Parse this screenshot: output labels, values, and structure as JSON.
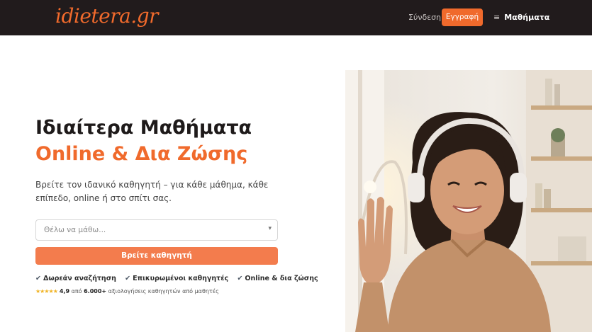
{
  "header": {
    "logo": "idietera.gr",
    "login_label": "Σύνδεση",
    "register_label": "Εγγραφή",
    "subjects_label": "Μαθήματα",
    "menu_glyph": "≡"
  },
  "hero": {
    "title_line1": "Ιδιαίτερα Μαθήματα",
    "title_line2": "Online & Δια Ζώσης",
    "subtitle": "Βρείτε τον ιδανικό καθηγητή – για κάθε μάθημα, κάθε επίπεδο, online ή στο σπίτι σας.",
    "select_placeholder": "Θέλω να μάθω...",
    "cta_label": "Βρείτε καθηγητή",
    "features": [
      "Δωρεάν αναζήτηση",
      "Επικυρωμένοι καθηγητές",
      "Online & δια ζώσης"
    ],
    "rating": {
      "stars": "★★★★★",
      "score": "4,9",
      "from_text": "από",
      "count": "6.000+",
      "suffix": "αξιολογήσεις καθηγητών από μαθητές"
    }
  },
  "colors": {
    "brand": "#f06a2c",
    "header_bg": "#211b1c",
    "cta_bg": "#f37c4d"
  }
}
